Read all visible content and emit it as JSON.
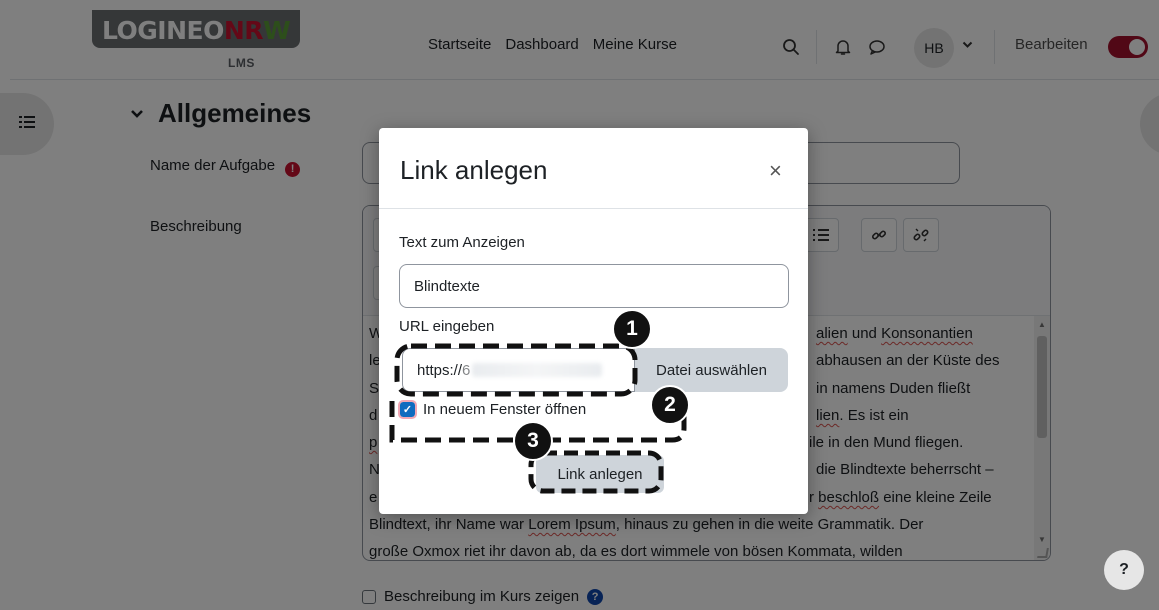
{
  "header": {
    "logo_main": "LOGINEO",
    "logo_nr": "NR",
    "logo_w": "W",
    "logo_sub": "LMS",
    "nav": [
      "Startseite",
      "Dashboard",
      "Meine Kurse"
    ],
    "avatar_initials": "HB",
    "edit_mode_label": "Bearbeiten",
    "edit_mode_on": true,
    "icons": [
      "search-icon",
      "bell-icon",
      "chat-icon",
      "chevron-down-icon"
    ]
  },
  "form": {
    "section_title": "Allgemeines",
    "name_label": "Name der Aufgabe",
    "description_label": "Beschreibung",
    "description_lines": [
      {
        "start": "W",
        "end_pre": "",
        "end_sp1": "alien",
        "end_mid": " und ",
        "end_sp2": "Konsonantien"
      },
      {
        "start": "le",
        "end_pre": "",
        "end_sp1": "",
        "end_mid": "abhausen an der Küste des",
        "end_sp2": ""
      },
      {
        "start": "S",
        "end_pre": "",
        "end_sp1": "",
        "end_mid": "in namens Duden fließt",
        "end_sp2": ""
      },
      {
        "start": "d",
        "end_pre": "",
        "end_sp1": "lien",
        "end_mid": ". Es ist ein",
        "end_sp2": ""
      },
      {
        "start": "p",
        "end_pre": "",
        "end_sp1": "",
        "end_mid": "ile in den Mund fliegen.",
        "end_sp2": ""
      },
      {
        "start": "N",
        "end_pre": "",
        "end_sp1": "",
        "end_mid": "die Blindtexte beherrscht –",
        "end_sp2": ""
      },
      {
        "start": "e",
        "end_pre": "r ",
        "end_sp1": "beschloß",
        "end_mid": " eine kleine Zeile",
        "end_sp2": ""
      }
    ],
    "description_full_lines": [
      {
        "a": "Blindtext, ihr Name war ",
        "sp": "Lorem Ipsum",
        "b": ", hinaus zu gehen in die weite Grammatik. Der"
      },
      {
        "a": "große ",
        "sp": "Oxmox",
        "b": " riet ihr davon ab, da es dort wimmele von bösen Kommata, wilden"
      }
    ],
    "show_description_label": "Beschreibung im Kurs zeigen",
    "help_label": "?"
  },
  "modal": {
    "title": "Link anlegen",
    "close_symbol": "×",
    "text_label": "Text zum Anzeigen",
    "text_value": "Blindtexte",
    "url_label": "URL eingeben",
    "url_value_visible": "https://",
    "url_blur_glyph": "6",
    "file_button": "Datei auswählen",
    "new_window_label": "In neuem Fenster öffnen",
    "new_window_checked": true,
    "submit_button": "Link anlegen"
  },
  "annotations": {
    "steps": [
      "1",
      "2",
      "3"
    ],
    "color": "#111111"
  }
}
